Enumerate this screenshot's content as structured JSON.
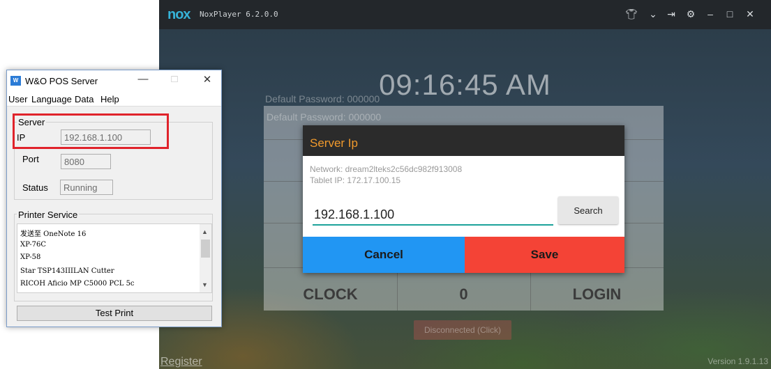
{
  "nox": {
    "logo": "nox",
    "version": "NoxPlayer 6.2.0.0",
    "controls": [
      "shirt-icon",
      "chevron-down-icon",
      "pin-icon",
      "gear-icon",
      "minimize-icon",
      "maximize-icon",
      "close-icon"
    ]
  },
  "app": {
    "clock": "09:16:45 AM",
    "default_password_1": "Default Password: 000000",
    "default_password_2": "Default Password: 000000",
    "clock_label": "CLOCK",
    "zero_label": "0",
    "login_label": "LOGIN",
    "disconnected": "Disconnected (Click)",
    "register": "Register",
    "version": "Version 1.9.1.13"
  },
  "dialog": {
    "title": "Server Ip",
    "network": "Network: dream2lteks2c56dc982f913008",
    "tablet_ip": "Tablet IP: 172.17.100.15",
    "ip_value": "192.168.1.100",
    "search_label": "Search",
    "cancel_label": "Cancel",
    "save_label": "Save",
    "colors": {
      "title_text": "#f19a2c",
      "cancel": "#2196f3",
      "save": "#f44336",
      "underline": "#1da39a"
    }
  },
  "pos": {
    "title": "W&O POS Server",
    "menu": [
      "User",
      "Language",
      "Data",
      "Help"
    ],
    "server_group": "Server",
    "ip_label": "IP",
    "ip_value": "192.168.1.100",
    "port_label": "Port",
    "port_value": "8080",
    "status_label": "Status",
    "status_value": "Running",
    "printer_group": "Printer Service",
    "printers": [
      "发送至 OneNote 16",
      "XP-76C",
      "XP-58",
      "Star TSP143IIILAN Cutter",
      "RICOH Aficio MP C5000 PCL 5c"
    ],
    "test_print": "Test Print",
    "highlight_color": "#e0232b"
  }
}
